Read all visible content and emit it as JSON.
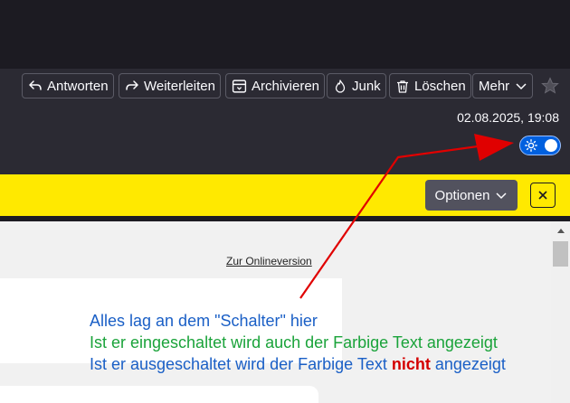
{
  "toolbar": {
    "reply_label": "Antworten",
    "forward_label": "Weiterleiten",
    "archive_label": "Archivieren",
    "junk_label": "Junk",
    "delete_label": "Löschen",
    "more_label": "Mehr"
  },
  "header": {
    "date": "02.08.2025, 19:08",
    "remote_content_toggle": "on"
  },
  "notification": {
    "options_label": "Optionen",
    "close_label": "✕"
  },
  "message": {
    "online_link": "Zur Onlineversion"
  },
  "annotation": {
    "line1": "Alles lag an dem \"Schalter\" hier",
    "line2": "Ist er eingeschaltet wird auch der Farbige Text angezeigt",
    "line3_start": "Ist er ausgeschaltet wird der Farbige Text ",
    "line3_emph": "nicht",
    "line3_end": " angezeigt"
  },
  "colors": {
    "toolbar_bg": "#2b2a33",
    "banner_bg": "#ffe900",
    "toggle_on": "#0060df",
    "arrow": "#e00000",
    "annotation_blue": "#1a5fc6",
    "annotation_green": "#1aa33a",
    "annotation_red": "#d40000"
  }
}
